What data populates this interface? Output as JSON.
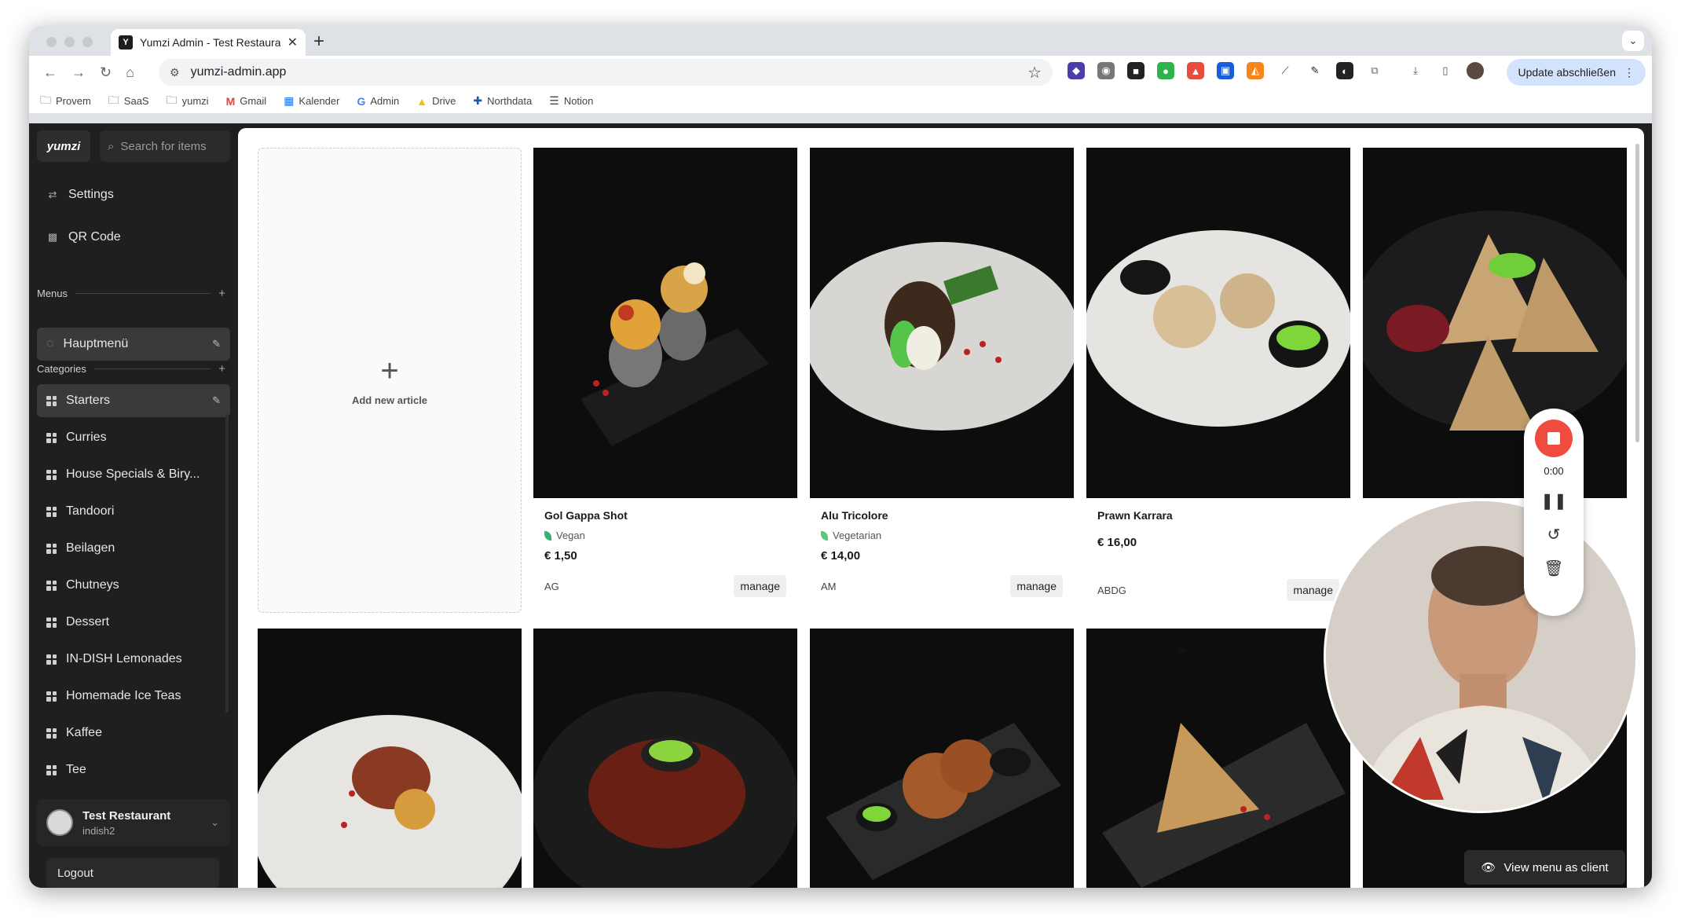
{
  "browser": {
    "tab_title": "Yumzi Admin - Test Restaurant",
    "tab_favicon": "Y",
    "url": "yumzi-admin.app",
    "update_button": "Update abschließen",
    "bookmarks": [
      "Provem",
      "SaaS",
      "yumzi",
      "Gmail",
      "Kalender",
      "Admin",
      "Drive",
      "Northdata",
      "Notion"
    ]
  },
  "sidebar": {
    "logo": "yumzi",
    "search_placeholder": "Search for items",
    "settings": "Settings",
    "qr_code": "QR Code",
    "menus_label": "Menus",
    "menu_item": "Hauptmenü",
    "categories_label": "Categories",
    "categories": [
      "Starters",
      "Curries",
      "House Specials & Biry...",
      "Tandoori",
      "Beilagen",
      "Chutneys",
      "Dessert",
      "IN-DISH Lemonades",
      "Homemade Ice Teas",
      "Kaffee",
      "Tee"
    ],
    "profile_name": "Test Restaurant",
    "profile_sub": "indish2",
    "logout": "Logout"
  },
  "content": {
    "add_label": "Add new article",
    "articles": [
      {
        "name": "Gol Gappa Shot",
        "diet": "Vegan",
        "price": "€ 1,50",
        "allergens": "AG",
        "action": "manage"
      },
      {
        "name": "Alu Tricolore",
        "diet": "Vegetarian",
        "price": "€ 14,00",
        "allergens": "AM",
        "action": "manage"
      },
      {
        "name": "Prawn Karrara",
        "diet": "",
        "price": "€ 16,00",
        "allergens": "ABDG",
        "action": "manage"
      }
    ]
  },
  "recorder": {
    "time": "0:00"
  },
  "view_menu_button": "View menu as client",
  "colors": {
    "sidebar_bg": "#1f1f1f",
    "record_red": "#ef4b3f",
    "vegan_green": "#3bb273"
  }
}
